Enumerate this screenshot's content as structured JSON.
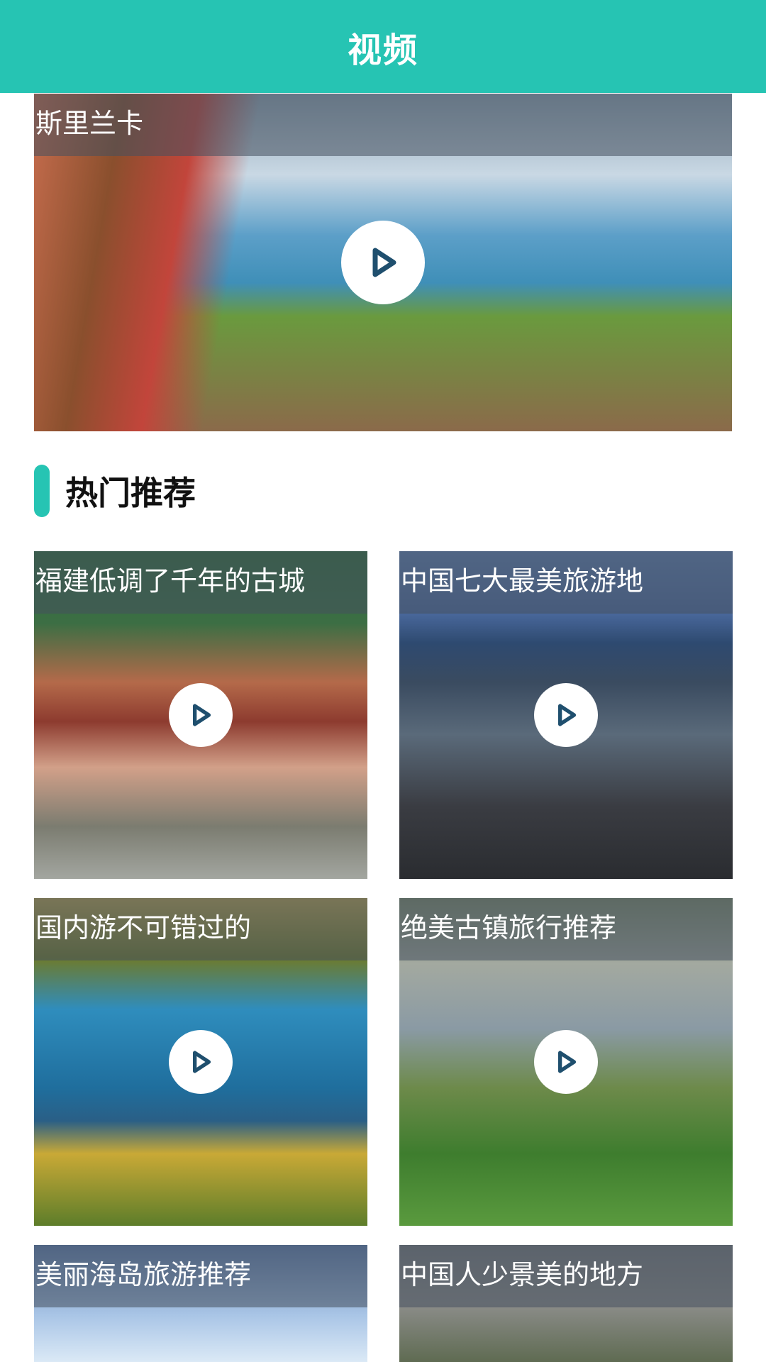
{
  "header": {
    "title": "视频"
  },
  "featured": {
    "caption": "斯里兰卡"
  },
  "section": {
    "title": "热门推荐"
  },
  "videos": [
    {
      "caption": "福建低调了千年的古城"
    },
    {
      "caption": "中国七大最美旅游地"
    },
    {
      "caption": "国内游不可错过的"
    },
    {
      "caption": "绝美古镇旅行推荐"
    },
    {
      "caption": "美丽海岛旅游推荐"
    },
    {
      "caption": "中国人少景美的地方"
    }
  ],
  "colors": {
    "accent": "#26c4b3",
    "play_icon": "#1f4f6e"
  },
  "icons": {
    "play": "play-icon"
  }
}
